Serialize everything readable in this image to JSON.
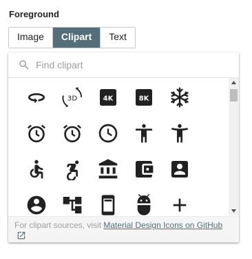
{
  "section": {
    "label": "Foreground"
  },
  "tabs": [
    {
      "label": "Image",
      "active": false
    },
    {
      "label": "Clipart",
      "active": true
    },
    {
      "label": "Text",
      "active": false
    }
  ],
  "search": {
    "placeholder": "Find clipart",
    "value": ""
  },
  "icons": [
    "rotate-360-icon",
    "3d-rotation-icon",
    "4k-icon",
    "8k-icon",
    "ac-unit-icon",
    "access-alarm-icon",
    "access-alarms-icon",
    "access-time-icon",
    "accessibility-icon",
    "accessibility-new-icon",
    "accessible-icon",
    "accessible-forward-icon",
    "account-balance-icon",
    "account-balance-wallet-icon",
    "account-box-icon",
    "account-circle-icon",
    "account-tree-icon",
    "ad-units-icon",
    "adb-icon",
    "add-icon"
  ],
  "footer": {
    "prefix": "For clipart sources, visit ",
    "link_text": "Material Design Icons on GitHub"
  },
  "colors": {
    "accent": "#546e7a",
    "icon": "#212121",
    "muted_text": "#9e9e9e"
  }
}
